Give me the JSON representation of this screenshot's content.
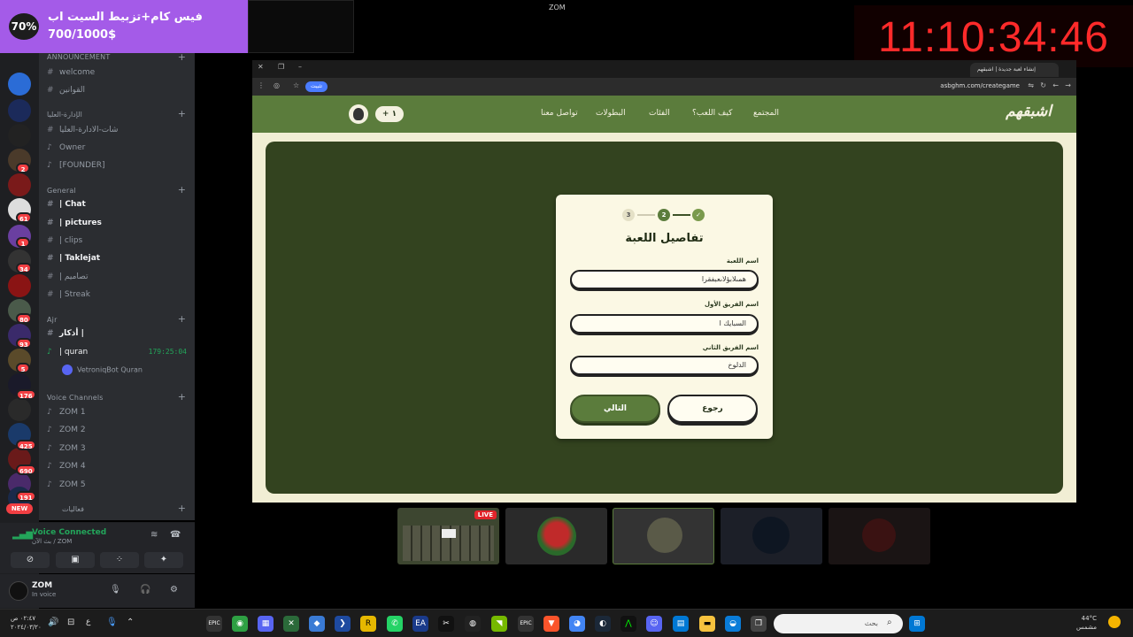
{
  "notification": {
    "percent": "70%",
    "title": "فيس كام+تزبيط السيت اب",
    "amount": "700/1000$"
  },
  "app_title": "ZOM",
  "clock": "11:10:34:46",
  "server_badges": [
    "2",
    "61",
    "1",
    "34",
    "80",
    "93",
    "5",
    "176",
    "425",
    "690",
    "191"
  ],
  "server_new": "NEW",
  "channels": {
    "announcement_cat": "ANNOUNCEMENT",
    "welcome": "welcome",
    "rules": "القوانين",
    "admin_cat": "الإدارة-العليا",
    "admin_chat": "شات-الادارة-العليا",
    "owner": "Owner",
    "founder": "[FOUNDER]",
    "general_cat": "General",
    "chat": "| Chat",
    "pictures": "| pictures",
    "clips": "| clips",
    "taklejat": "| Taklejat",
    "designs": "| تصاميم",
    "streak": "| Streak",
    "ajr_cat": "Ajr",
    "azkar": "أذكار |",
    "quran": "| quran",
    "quran_timer": "179:25:04",
    "quran_bot": "VetroniqBot Quran",
    "voice_cat": "Voice Channels",
    "zom1": "ZOM 1",
    "zom2": "ZOM 2",
    "zom3": "ZOM 3",
    "zom4": "ZOM 4",
    "zom5": "ZOM 5",
    "events_cat": "فعاليات"
  },
  "voice": {
    "title": "Voice Connected",
    "sub": "بث الآن / ZOM"
  },
  "user": {
    "name": "ZOM",
    "status": "In voice"
  },
  "browser": {
    "tab_title": "إنشاء لعبة جديدة | اشبقهم",
    "url": "asbghm.com/creategame",
    "install_pill": "تثبيت"
  },
  "site": {
    "logo": "اشبقهم",
    "nav": [
      "المجتمع",
      "كيف اللعب؟",
      "الفئات",
      "البطولات",
      "تواصل معنا"
    ],
    "add_label": "+ ١"
  },
  "form": {
    "steps": [
      "3",
      "2",
      "✓"
    ],
    "title": "تفاصيل اللعبة",
    "game_name_label": "اسم اللعبة",
    "game_name_value": "همىلابؤلاىعبفقرا",
    "team1_label": "اسم الفريق الأول",
    "team1_value": "السبايك ا",
    "team2_label": "اسم الفريق الثاني",
    "team2_value": "الدلوخ",
    "next_label": "التالي",
    "back_label": "رجوع"
  },
  "thumbs": {
    "live": "LIVE"
  },
  "taskbar": {
    "time": "٠٢:٤٧ ص",
    "date": "٢٠٢٤/٠٣/٢٠",
    "search_placeholder": "بحث",
    "temp": "44°C",
    "weather": "مشمس",
    "lang": "ع"
  }
}
